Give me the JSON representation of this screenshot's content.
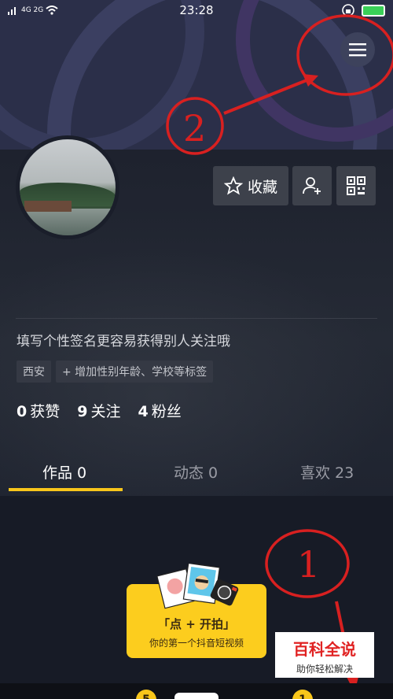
{
  "status_bar": {
    "signal_text": "4G 2G",
    "time": "23:28"
  },
  "profile": {
    "signature": "填写个性签名更容易获得别人关注哦",
    "location_tag": "西安",
    "add_tag": "+ 增加性别年龄、学校等标签"
  },
  "actions": {
    "favorite_label": "收藏"
  },
  "stats": {
    "likes_count": "0",
    "likes_label": "获赞",
    "following_count": "9",
    "following_label": "关注",
    "followers_count": "4",
    "followers_label": "粉丝"
  },
  "tabs": [
    {
      "label": "作品 0"
    },
    {
      "label": "动态 0"
    },
    {
      "label": "喜欢 23"
    }
  ],
  "prompt_bubble": {
    "title": "「点 + 开拍」",
    "subtitle": "你的第一个抖音短视频"
  },
  "annotations": {
    "num_one": "1",
    "num_two": "2"
  },
  "bottom_nav": {
    "badge_left": "5",
    "badge_right": "1"
  },
  "watermark": {
    "title": "百科全说",
    "subtitle": "助你轻松解决"
  },
  "colors": {
    "accent_yellow": "#fccd1e",
    "annotation_red": "#d82020",
    "header_bg": "#2b2f49"
  }
}
